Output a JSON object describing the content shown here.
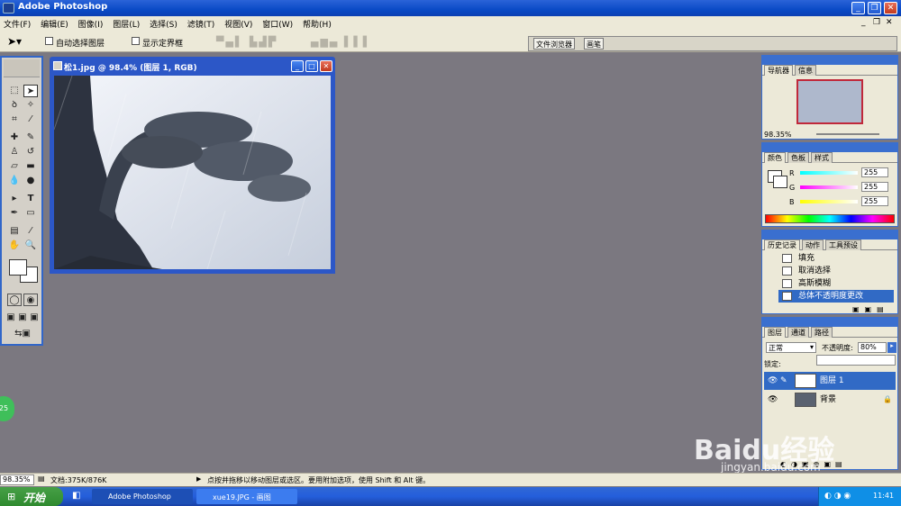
{
  "app": {
    "title": "Adobe Photoshop"
  },
  "menu": [
    "文件(F)",
    "编辑(E)",
    "图像(I)",
    "图层(L)",
    "选择(S)",
    "滤镜(T)",
    "视图(V)",
    "窗口(W)",
    "帮助(H)"
  ],
  "options": {
    "auto_select_label": "自动选择图层",
    "show_bounds_label": "显示定界框",
    "file_browser_tab": "文件浏览器",
    "brushes_tab": "画笔"
  },
  "document": {
    "title": "松1.jpg @ 98.4% (图层 1, RGB)"
  },
  "navigator": {
    "tabs": [
      "导航器",
      "信息"
    ],
    "zoom": "98.35%"
  },
  "color": {
    "tabs": [
      "颜色",
      "色板",
      "样式"
    ],
    "channels": [
      {
        "label": "R",
        "value": "255"
      },
      {
        "label": "G",
        "value": "255"
      },
      {
        "label": "B",
        "value": "255"
      }
    ]
  },
  "history": {
    "tabs": [
      "历史记录",
      "动作",
      "工具预设"
    ],
    "items": [
      "填充",
      "取消选择",
      "高斯模糊",
      "总体不透明度更改"
    ]
  },
  "layers": {
    "tabs": [
      "图层",
      "通道",
      "路径"
    ],
    "blend_mode": "正常",
    "opacity_label": "不透明度:",
    "opacity_value": "80%",
    "lock_label": "锁定:",
    "items": [
      "图层 1",
      "背景"
    ]
  },
  "status": {
    "zoom": "98.35%",
    "doc_size": "文档:375K/876K",
    "hint": "点按并拖移以移动图层或选区。要用附加选项，使用 Shift 和 Alt 键。"
  },
  "taskbar": {
    "start_label": "开始",
    "items": [
      "Adobe Photoshop",
      "xue19.JPG - 画图"
    ],
    "clock": "11:41"
  },
  "watermark": {
    "brand": "Baidu经验",
    "url": "jingyan.baidu.com"
  },
  "floating_badge": "25",
  "colors": {
    "xp_blue": "#2a63d8",
    "workspace": "#7b7880",
    "selection": "#316ac5"
  }
}
